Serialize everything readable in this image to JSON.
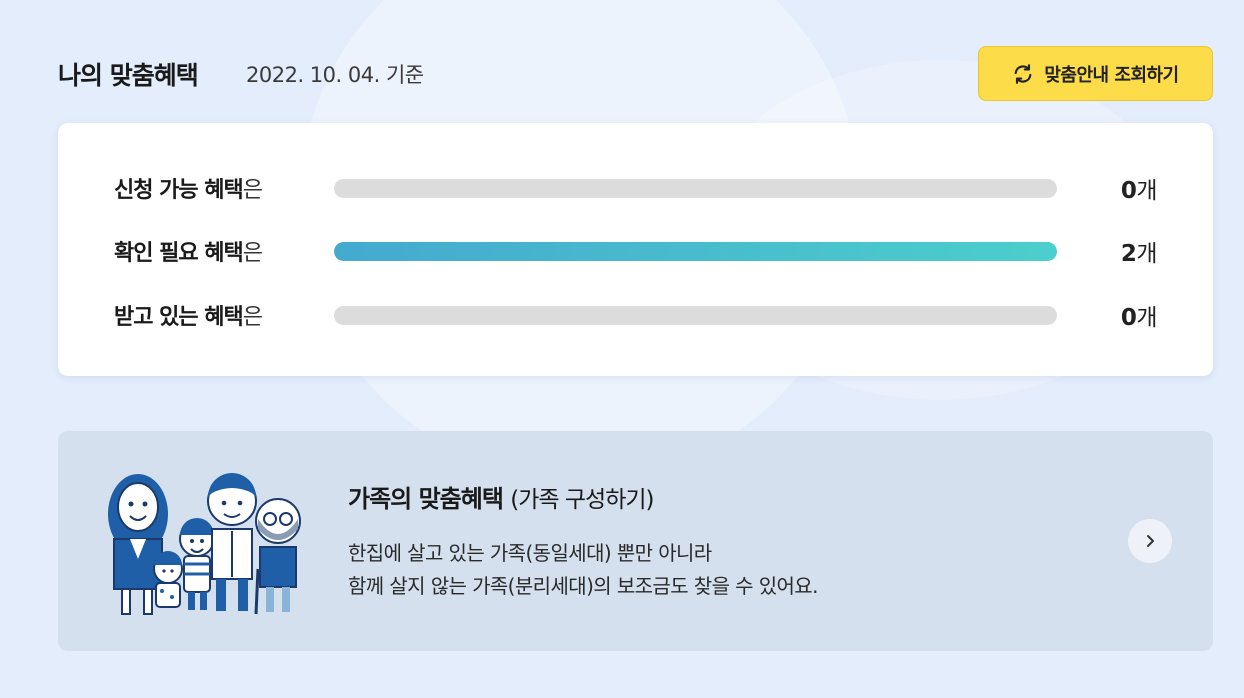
{
  "header": {
    "title": "나의 맞춤혜택",
    "date": "2022. 10. 04. 기준",
    "refresh_label": "맞춤안내 조회하기"
  },
  "summary": {
    "rows": [
      {
        "label_bold": "신청 가능 혜택",
        "label_suffix": "은",
        "count": "0",
        "unit": "개",
        "fill": 0
      },
      {
        "label_bold": "확인 필요 혜택",
        "label_suffix": "은",
        "count": "2",
        "unit": "개",
        "fill": 1
      },
      {
        "label_bold": "받고 있는 혜택",
        "label_suffix": "은",
        "count": "0",
        "unit": "개",
        "fill": 0
      }
    ]
  },
  "family": {
    "title": "가족의 맞춤혜택",
    "title_sub": "(가족 구성하기)",
    "desc_line1": "한집에 살고 있는 가족(동일세대) 뿐만 아니라",
    "desc_line2": "함께 살지 않는 가족(분리세대)의 보조금도 찾을 수 있어요."
  },
  "icons": {
    "refresh": "refresh-icon",
    "arrow": "chevron-right-icon",
    "family": "family-illustration"
  },
  "colors": {
    "accent_yellow": "#fddc4a",
    "bar_gradient_start": "#45a9cf",
    "bar_gradient_end": "#4bcfcc",
    "bar_track": "#dcdcdc"
  }
}
